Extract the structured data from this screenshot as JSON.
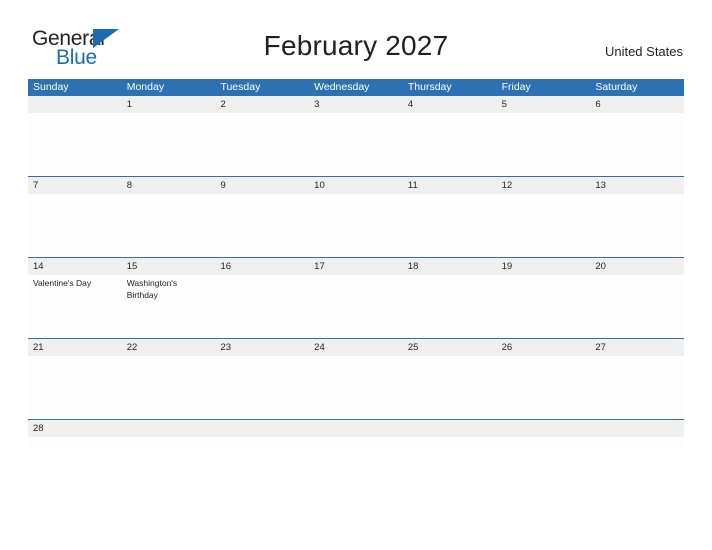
{
  "brand": {
    "name_line1": "General",
    "name_line2": "Blue",
    "flag_icon": "flag-triangle-icon",
    "accent_color": "#1b6cb0"
  },
  "header": {
    "title": "February 2027",
    "region": "United States"
  },
  "colors": {
    "header_blue": "#2e71b2",
    "row_strip_gray": "#efefef",
    "text": "#231f20"
  },
  "calendar": {
    "weekdays": [
      "Sunday",
      "Monday",
      "Tuesday",
      "Wednesday",
      "Thursday",
      "Friday",
      "Saturday"
    ],
    "weeks": [
      {
        "days": [
          {
            "num": "",
            "events": []
          },
          {
            "num": "1",
            "events": []
          },
          {
            "num": "2",
            "events": []
          },
          {
            "num": "3",
            "events": []
          },
          {
            "num": "4",
            "events": []
          },
          {
            "num": "5",
            "events": []
          },
          {
            "num": "6",
            "events": []
          }
        ]
      },
      {
        "days": [
          {
            "num": "7",
            "events": []
          },
          {
            "num": "8",
            "events": []
          },
          {
            "num": "9",
            "events": []
          },
          {
            "num": "10",
            "events": []
          },
          {
            "num": "11",
            "events": []
          },
          {
            "num": "12",
            "events": []
          },
          {
            "num": "13",
            "events": []
          }
        ]
      },
      {
        "days": [
          {
            "num": "14",
            "events": [
              "Valentine's Day"
            ]
          },
          {
            "num": "15",
            "events": [
              "Washington's Birthday"
            ]
          },
          {
            "num": "16",
            "events": []
          },
          {
            "num": "17",
            "events": []
          },
          {
            "num": "18",
            "events": []
          },
          {
            "num": "19",
            "events": []
          },
          {
            "num": "20",
            "events": []
          }
        ]
      },
      {
        "days": [
          {
            "num": "21",
            "events": []
          },
          {
            "num": "22",
            "events": []
          },
          {
            "num": "23",
            "events": []
          },
          {
            "num": "24",
            "events": []
          },
          {
            "num": "25",
            "events": []
          },
          {
            "num": "26",
            "events": []
          },
          {
            "num": "27",
            "events": []
          }
        ]
      },
      {
        "short": true,
        "days": [
          {
            "num": "28",
            "events": []
          },
          {
            "num": "",
            "events": []
          },
          {
            "num": "",
            "events": []
          },
          {
            "num": "",
            "events": []
          },
          {
            "num": "",
            "events": []
          },
          {
            "num": "",
            "events": []
          },
          {
            "num": "",
            "events": []
          }
        ]
      }
    ]
  }
}
